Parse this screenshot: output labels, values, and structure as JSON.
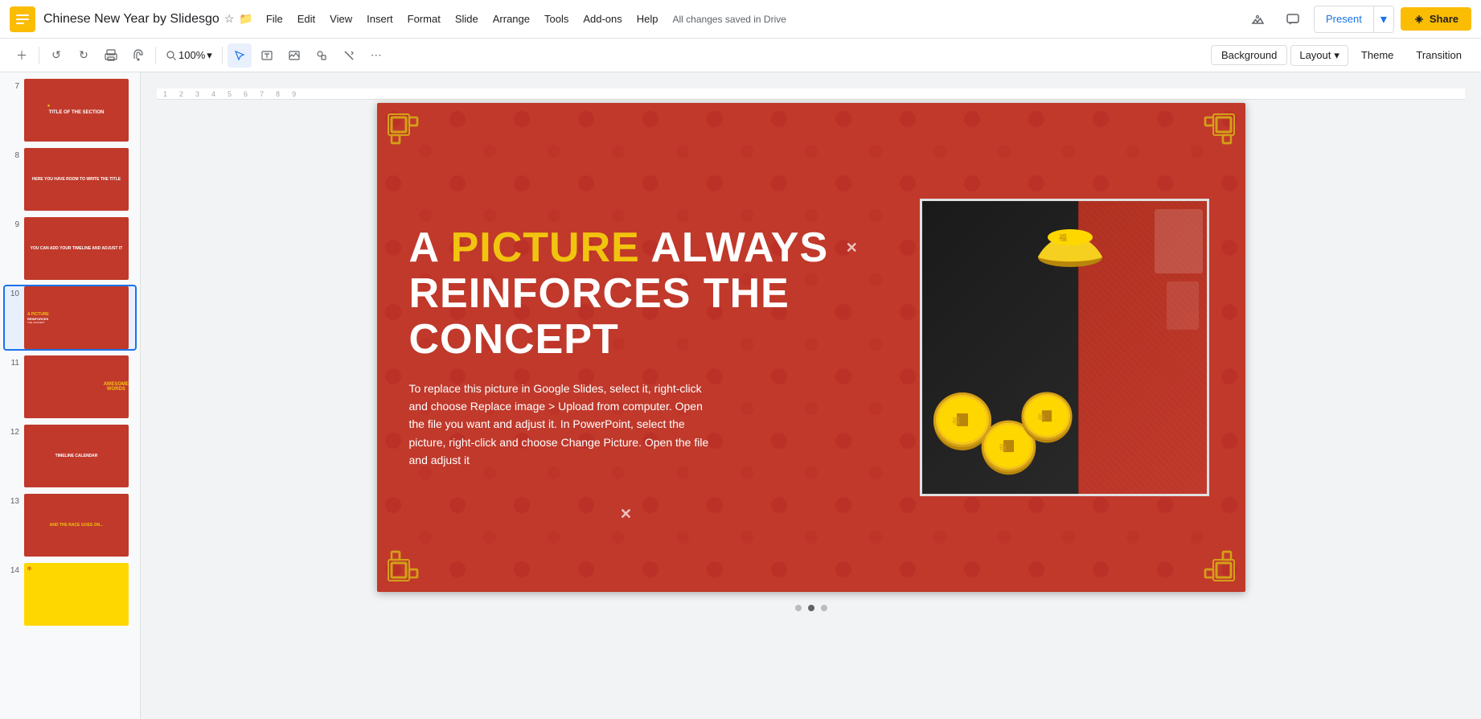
{
  "app": {
    "logo_color": "#FBBC04",
    "title": "Chinese New Year by Slidesgo",
    "save_status": "All changes saved in Drive"
  },
  "menu": {
    "items": [
      "File",
      "Edit",
      "View",
      "Insert",
      "Format",
      "Slide",
      "Arrange",
      "Tools",
      "Add-ons",
      "Help"
    ]
  },
  "toolbar": {
    "zoom": "100%",
    "background_label": "Background",
    "layout_label": "Layout",
    "theme_label": "Theme",
    "transition_label": "Transition"
  },
  "present_button": {
    "label": "Present"
  },
  "share_button": {
    "label": "Share"
  },
  "slides": [
    {
      "num": "7",
      "active": false
    },
    {
      "num": "8",
      "active": false
    },
    {
      "num": "9",
      "active": false
    },
    {
      "num": "10",
      "active": true
    },
    {
      "num": "11",
      "active": false
    },
    {
      "num": "12",
      "active": false
    },
    {
      "num": "13",
      "active": false
    },
    {
      "num": "14",
      "active": false
    }
  ],
  "slide": {
    "title_part1": "A ",
    "title_highlight": "PICTURE",
    "title_part2": " ALWAYS",
    "title_line2": "REINFORCES THE CONCEPT",
    "body_text": "To replace this picture in Google Slides, select it, right-click and choose Replace image > Upload from computer. Open the file you want and adjust it. In PowerPoint, select the picture, right-click and choose Change Picture. Open the file and adjust it",
    "bg_color": "#c0392b"
  },
  "pagination": {
    "dots": [
      1,
      2,
      3
    ]
  }
}
